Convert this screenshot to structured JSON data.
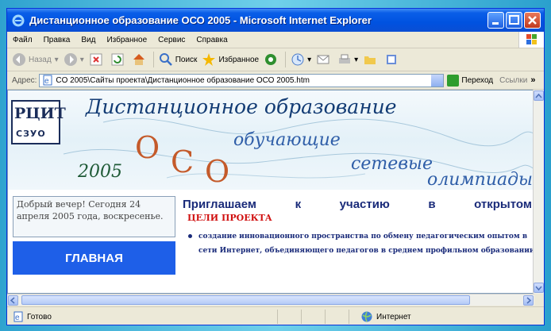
{
  "window": {
    "title": "Дистанционное образование ОСО 2005 - Microsoft Internet Explorer"
  },
  "menu": {
    "items": [
      "Файл",
      "Правка",
      "Вид",
      "Избранное",
      "Сервис",
      "Справка"
    ]
  },
  "toolbar": {
    "back_label": "Назад",
    "search_label": "Поиск",
    "favorites_label": "Избранное"
  },
  "address": {
    "label": "Адрес:",
    "value": "CO 2005\\Сайты проекта\\Дистанционное образование ОСО 2005.htm",
    "go_label": "Переход",
    "links_label": "Ссылки"
  },
  "page": {
    "logo_text": "РЦИТ",
    "logo_subtext": "СЗУО",
    "banner_title": "Дистанционное образование",
    "banner_year": "2005",
    "banner_oco": [
      "О",
      "С",
      "О"
    ],
    "banner_training": "обучающие",
    "banner_network": "сетевые",
    "banner_olympiads": "олимпиады",
    "greeting": "Добрый вечер! Сегодня 24 апреля 2005 года, воскресенье.",
    "main_button": "ГЛАВНАЯ",
    "invite_words": [
      "Приглашаем",
      "к",
      "участию",
      "в",
      "открытом"
    ],
    "goals_heading": "ЦЕЛИ ПРОЕКТА",
    "goal_item": "создание инновационного пространства по обмену педагогическим опытом в сети Интернет, объединяющего педагогов в среднем профильном образовании"
  },
  "status": {
    "left_text": "Готово",
    "zone_text": "Интернет"
  },
  "colors": {
    "titlebar": "#0052e0",
    "main_button": "#1e5fe8",
    "goals_heading": "#d01010",
    "invite_text": "#1a2b7a"
  }
}
